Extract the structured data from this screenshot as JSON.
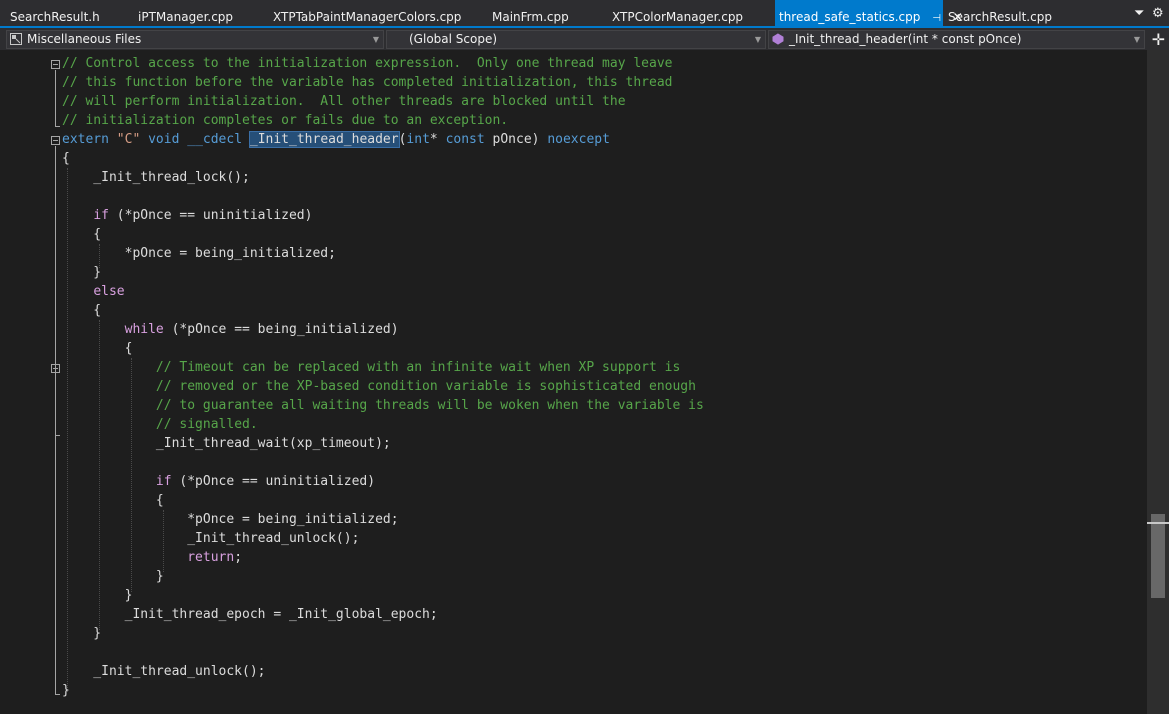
{
  "tabs": [
    {
      "label": "SearchResult.h",
      "active": false
    },
    {
      "label": "iPTManager.cpp",
      "active": false
    },
    {
      "label": "XTPTabPaintManagerColors.cpp",
      "active": false
    },
    {
      "label": "MainFrm.cpp",
      "active": false
    },
    {
      "label": "XTPColorManager.cpp",
      "active": false
    },
    {
      "label": "thread_safe_statics.cpp",
      "active": true
    },
    {
      "label": "SearchResult.cpp",
      "active": false
    }
  ],
  "active_tab": {
    "pin_glyph": "⊣",
    "close_glyph": "✕"
  },
  "navbar": {
    "project": "Miscellaneous Files",
    "scope": "(Global Scope)",
    "member": "_Init_thread_header(int * const pOnce)"
  },
  "colors": {
    "accent": "#007acc",
    "comment": "#57a64a",
    "keyword": "#569cd6",
    "control": "#d8a0df",
    "string": "#d69d85",
    "text": "#dcdcdc",
    "selection": "#264f78"
  },
  "code": [
    [
      [
        "c",
        "// Control access to the initialization expression.  Only one thread may leave"
      ]
    ],
    [
      [
        "c",
        "// this function before the variable has completed initialization, this thread"
      ]
    ],
    [
      [
        "c",
        "// will perform initialization.  All other threads are blocked until the"
      ]
    ],
    [
      [
        "c",
        "// initialization completes or fails due to an exception."
      ]
    ],
    [
      [
        "k",
        "extern"
      ],
      [
        "p",
        " "
      ],
      [
        "s",
        "\"C\""
      ],
      [
        "p",
        " "
      ],
      [
        "k",
        "void"
      ],
      [
        "p",
        " "
      ],
      [
        "k",
        "__cdecl"
      ],
      [
        "p",
        " "
      ],
      [
        "h",
        "_Init_thread_header"
      ],
      [
        "p",
        "("
      ],
      [
        "k",
        "int"
      ],
      [
        "p",
        "* "
      ],
      [
        "k",
        "const"
      ],
      [
        "p",
        " pOnce) "
      ],
      [
        "k",
        "noexcept"
      ]
    ],
    [
      [
        "p",
        "{"
      ]
    ],
    [
      [
        "p",
        "    _Init_thread_lock();"
      ]
    ],
    [
      [
        "p",
        ""
      ]
    ],
    [
      [
        "p",
        "    "
      ],
      [
        "x",
        "if"
      ],
      [
        "p",
        " (*pOnce == uninitialized)"
      ]
    ],
    [
      [
        "p",
        "    {"
      ]
    ],
    [
      [
        "p",
        "        *pOnce = being_initialized;"
      ]
    ],
    [
      [
        "p",
        "    }"
      ]
    ],
    [
      [
        "p",
        "    "
      ],
      [
        "x",
        "else"
      ]
    ],
    [
      [
        "p",
        "    {"
      ]
    ],
    [
      [
        "p",
        "        "
      ],
      [
        "x",
        "while"
      ],
      [
        "p",
        " (*pOnce == being_initialized)"
      ]
    ],
    [
      [
        "p",
        "        {"
      ]
    ],
    [
      [
        "p",
        "            "
      ],
      [
        "c",
        "// Timeout can be replaced with an infinite wait when XP support is"
      ]
    ],
    [
      [
        "p",
        "            "
      ],
      [
        "c",
        "// removed or the XP-based condition variable is sophisticated enough"
      ]
    ],
    [
      [
        "p",
        "            "
      ],
      [
        "c",
        "// to guarantee all waiting threads will be woken when the variable is"
      ]
    ],
    [
      [
        "p",
        "            "
      ],
      [
        "c",
        "// signalled."
      ]
    ],
    [
      [
        "p",
        "            _Init_thread_wait(xp_timeout);"
      ]
    ],
    [
      [
        "p",
        ""
      ]
    ],
    [
      [
        "p",
        "            "
      ],
      [
        "x",
        "if"
      ],
      [
        "p",
        " (*pOnce == uninitialized)"
      ]
    ],
    [
      [
        "p",
        "            {"
      ]
    ],
    [
      [
        "p",
        "                *pOnce = being_initialized;"
      ]
    ],
    [
      [
        "p",
        "                _Init_thread_unlock();"
      ]
    ],
    [
      [
        "p",
        "                "
      ],
      [
        "x",
        "return"
      ],
      [
        "p",
        ";"
      ]
    ],
    [
      [
        "p",
        "            }"
      ]
    ],
    [
      [
        "p",
        "        }"
      ]
    ],
    [
      [
        "p",
        "        _Init_thread_epoch = _Init_global_epoch;"
      ]
    ],
    [
      [
        "p",
        "    }"
      ]
    ],
    [
      [
        "p",
        ""
      ]
    ],
    [
      [
        "p",
        "    _Init_thread_unlock();"
      ]
    ],
    [
      [
        "p",
        "}"
      ]
    ]
  ]
}
